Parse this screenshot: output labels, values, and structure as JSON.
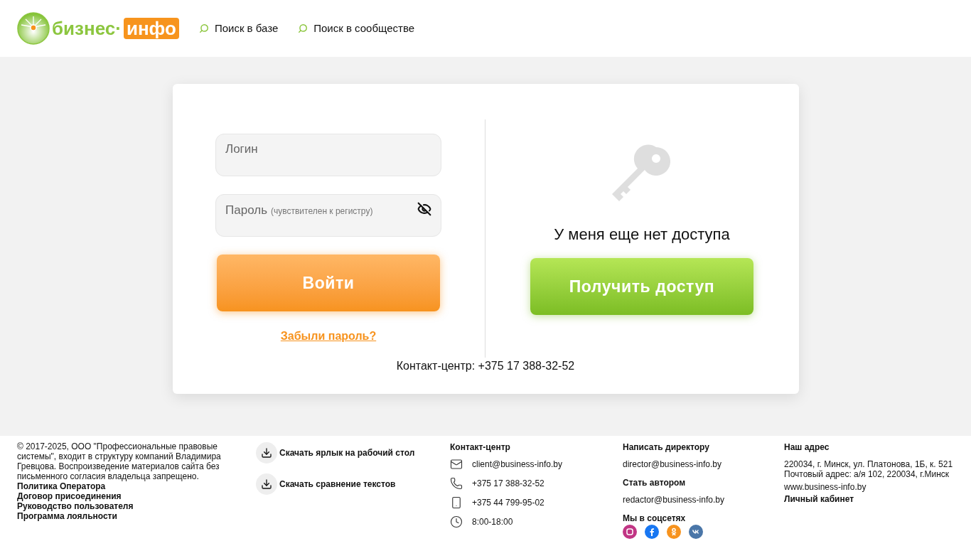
{
  "header": {
    "logo": {
      "word": "бизнес·",
      "badge": "инфо"
    },
    "links": [
      "Поиск в базе",
      "Поиск в сообществе"
    ]
  },
  "login": {
    "login_label": "Логин",
    "password_label": "Пароль",
    "password_hint": "(чувствителен к регистру)",
    "password_visible": false,
    "submit": "Войти",
    "forgot": "Забыли пароль?"
  },
  "access": {
    "text": "У меня еще нет доступа",
    "button": "Получить доступ"
  },
  "contact": "Контакт-центр: +375 17 388-32-52",
  "footer": {
    "copyright": "© 2017-2025, ООО \"Профессиональные правовые системы\", входит в структуру компаний Владимира Гревцова. Воспроизведение материалов сайта без письменного согласия владельца запрещено.",
    "links": [
      "Политика Оператора",
      "Договор присоединения",
      "Руководство пользователя",
      "Программа лояльности"
    ],
    "downloads": [
      "Скачать ярлык на рабочий стол",
      "Скачать сравнение текстов"
    ],
    "contact_title": "Контакт-центр",
    "contacts": [
      {
        "kind": "mail",
        "text": "client@business-info.by"
      },
      {
        "kind": "phone",
        "text": "+375 17 388-32-52"
      },
      {
        "kind": "mobile",
        "text": "+375 44 799-95-02"
      },
      {
        "kind": "clock",
        "text": "8:00-18:00"
      }
    ],
    "director_title": "Написать директору",
    "director_email": "director@business-info.by",
    "author_title": "Стать автором",
    "author_email": "redactor@business-info.by",
    "social_title": "Мы в соцсетях",
    "social": [
      {
        "kind": "instagram",
        "color": "#c13584"
      },
      {
        "kind": "facebook",
        "color": "#1877f2"
      },
      {
        "kind": "ok",
        "color": "#f7931e"
      },
      {
        "kind": "vk",
        "color": "#4a76a8"
      }
    ],
    "address_title": "Наш адрес",
    "address": [
      "220034, г. Минск, ул. Платонова, 1Б, к. 521",
      "Почтовый адрес: а/я 102, 220034, г.Минск"
    ],
    "site": "www.business-info.by",
    "cabinet": "Личный кабинет"
  }
}
